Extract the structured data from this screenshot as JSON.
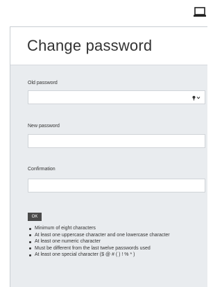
{
  "form": {
    "title": "Change password",
    "old_password_label": "Old password",
    "old_password_value": "",
    "new_password_label": "New password",
    "new_password_value": "",
    "confirmation_label": "Confirmation",
    "confirmation_value": "",
    "ok_label": "OK"
  },
  "rules": [
    "Minimum of eight characters",
    "At least one uppercase character and one lowercase character",
    "At least one numeric character",
    "Must be different from the last twelve passwords used",
    "At least one special character ($ @ # ( ) ! % * )"
  ],
  "icons": {
    "top_right": "monitor-icon",
    "password_field": "key-icon"
  },
  "colors": {
    "panel_background": "#e9ecef",
    "button_background": "#4a4a4a",
    "text": "#333333"
  }
}
